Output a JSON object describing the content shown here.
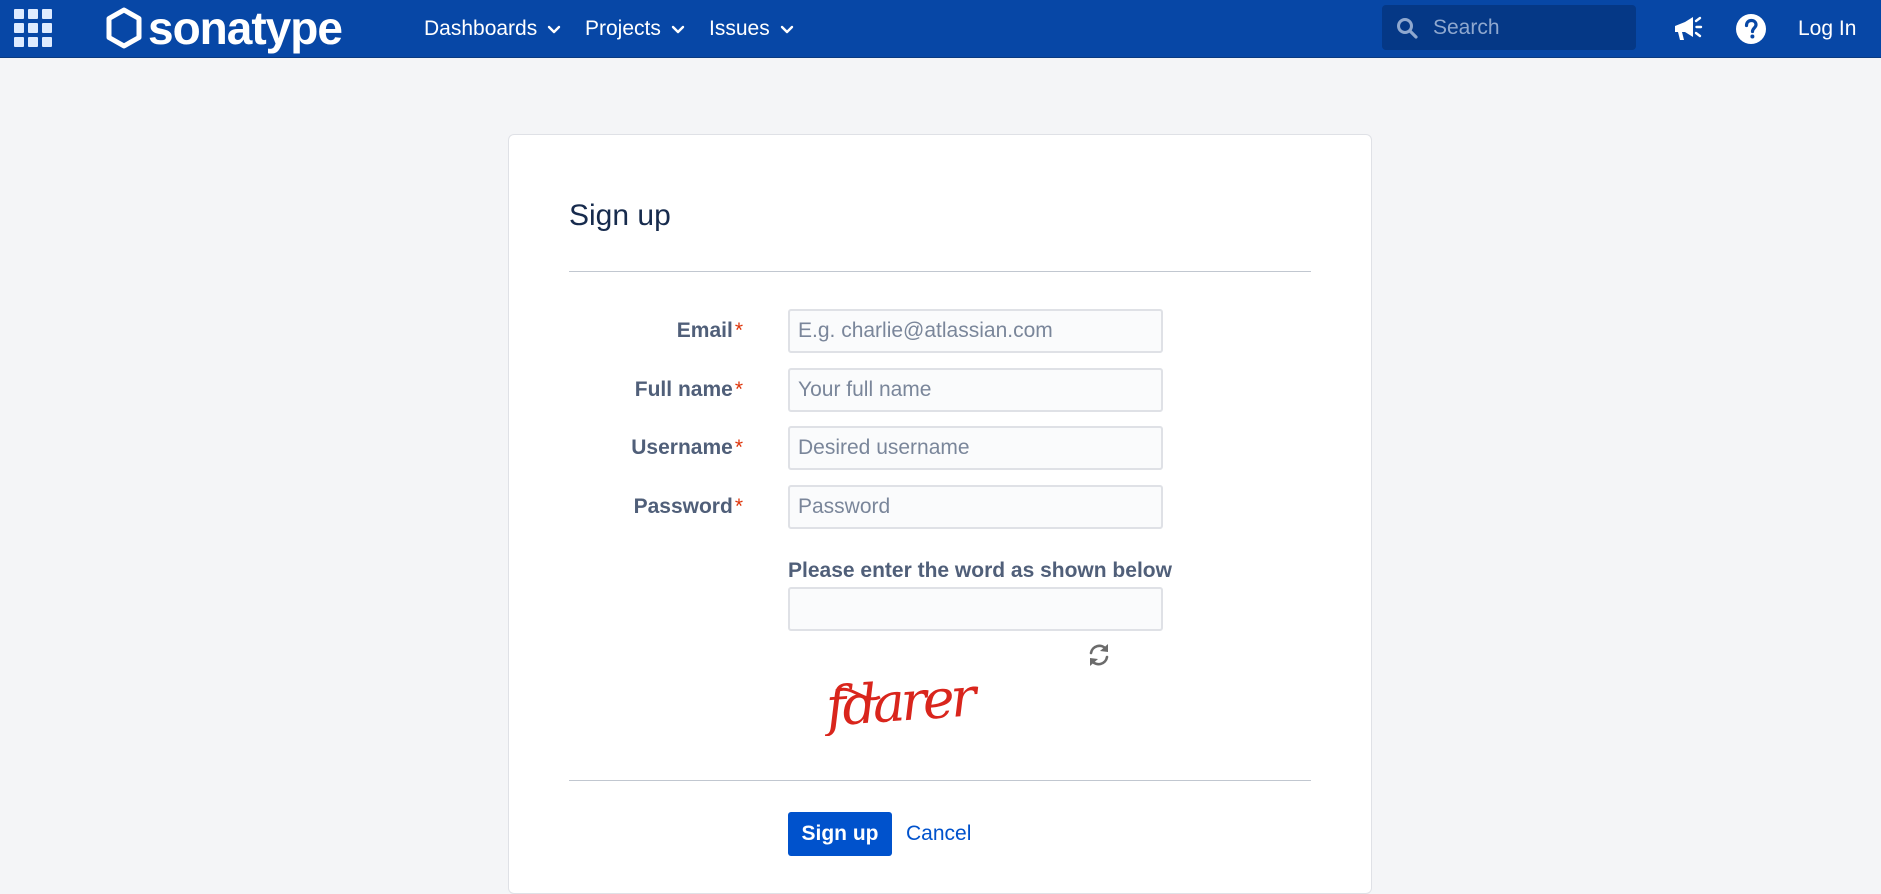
{
  "header": {
    "logo_text": "sonatype",
    "nav": [
      {
        "label": "Dashboards"
      },
      {
        "label": "Projects"
      },
      {
        "label": "Issues"
      }
    ],
    "search_placeholder": "Search",
    "login_label": "Log In",
    "icons": [
      "app-switcher-icon",
      "chevron-down-icon",
      "search-icon",
      "megaphone-icon",
      "help-icon"
    ]
  },
  "form": {
    "title": "Sign up",
    "fields": {
      "email": {
        "label": "Email",
        "required_mark": "*",
        "placeholder": "E.g. charlie@atlassian.com",
        "value": ""
      },
      "fullname": {
        "label": "Full name",
        "required_mark": "*",
        "placeholder": "Your full name",
        "value": ""
      },
      "username": {
        "label": "Username",
        "required_mark": "*",
        "placeholder": "Desired username",
        "value": ""
      },
      "password": {
        "label": "Password",
        "required_mark": "*",
        "placeholder": "Password",
        "value": ""
      }
    },
    "captcha": {
      "label": "Please enter the word as shown below",
      "value": "",
      "word": "fdarer",
      "refresh_icon": "refresh-icon"
    },
    "submit_label": "Sign up",
    "cancel_label": "Cancel"
  },
  "colors": {
    "header_bg": "#0747a6",
    "primary": "#0052cc",
    "required": "#de350b",
    "page_bg": "#f4f5f7",
    "captcha_red": "#d9251c"
  }
}
